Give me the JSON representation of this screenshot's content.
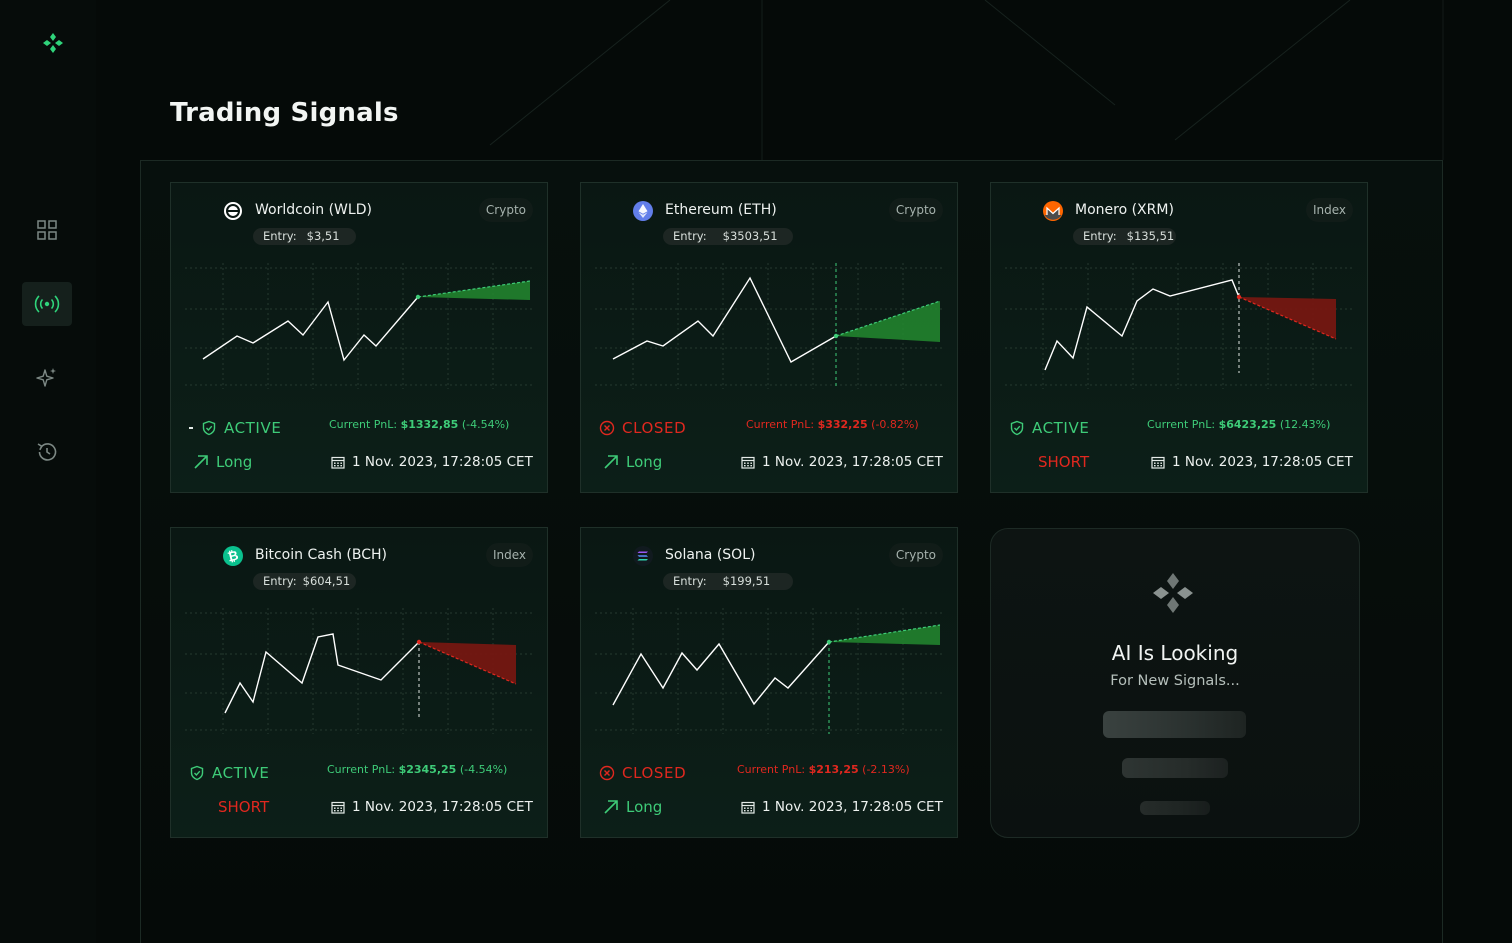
{
  "page": {
    "title": "Trading Signals"
  },
  "sidebar": {
    "items": [
      {
        "icon": "dashboard-grid-icon",
        "active": false
      },
      {
        "icon": "signal-broadcast-icon",
        "active": true
      },
      {
        "icon": "sparkle-ai-icon",
        "active": false
      },
      {
        "icon": "history-clock-icon",
        "active": false
      }
    ]
  },
  "signals": [
    {
      "name": "Worldcoin (WLD)",
      "tag": "Crypto",
      "entry_label": "Entry:",
      "entry_value": "$3,51",
      "status": "ACTIVE",
      "pnl_label": "Current PnL:",
      "pnl_value": "$1332,85",
      "pnl_pct": "(-4.54%)",
      "direction": "Long",
      "date": "1 Nov. 2023, 17:28:05 CET",
      "outcome": "up"
    },
    {
      "name": "Ethereum (ETH)",
      "tag": "Crypto",
      "entry_label": "Entry:",
      "entry_value": "$3503,51",
      "status": "CLOSED",
      "pnl_label": "Current PnL:",
      "pnl_value": "$332,25",
      "pnl_pct": "(-0.82%)",
      "direction": "Long",
      "date": "1 Nov. 2023, 17:28:05 CET",
      "outcome": "up"
    },
    {
      "name": "Monero (XRM)",
      "tag": "Index",
      "entry_label": "Entry:",
      "entry_value": "$135,51",
      "status": "ACTIVE",
      "pnl_label": "Current PnL:",
      "pnl_value": "$6423,25",
      "pnl_pct": "(12.43%)",
      "direction": "SHORT",
      "date": "1 Nov. 2023, 17:28:05 CET",
      "outcome": "down"
    },
    {
      "name": "Bitcoin Cash (BCH)",
      "tag": "Index",
      "entry_label": "Entry:",
      "entry_value": "$604,51",
      "status": "ACTIVE",
      "pnl_label": "Current PnL:",
      "pnl_value": "$2345,25",
      "pnl_pct": "(-4.54%)",
      "direction": "SHORT",
      "date": "1 Nov. 2023, 17:28:05 CET",
      "outcome": "down"
    },
    {
      "name": "Solana (SOL)",
      "tag": "Crypto",
      "entry_label": "Entry:",
      "entry_value": "$199,51",
      "status": "CLOSED",
      "pnl_label": "Current PnL:",
      "pnl_value": "$213,25",
      "pnl_pct": "(-2.13%)",
      "direction": "Long",
      "date": "1 Nov. 2023, 17:28:05 CET",
      "outcome": "up"
    }
  ],
  "ai_card": {
    "title": "AI Is Looking",
    "subtitle": "For New Signals..."
  },
  "colors": {
    "accent_green": "#3ecb78",
    "alert_red": "#e0281f",
    "background": "#050a08"
  }
}
